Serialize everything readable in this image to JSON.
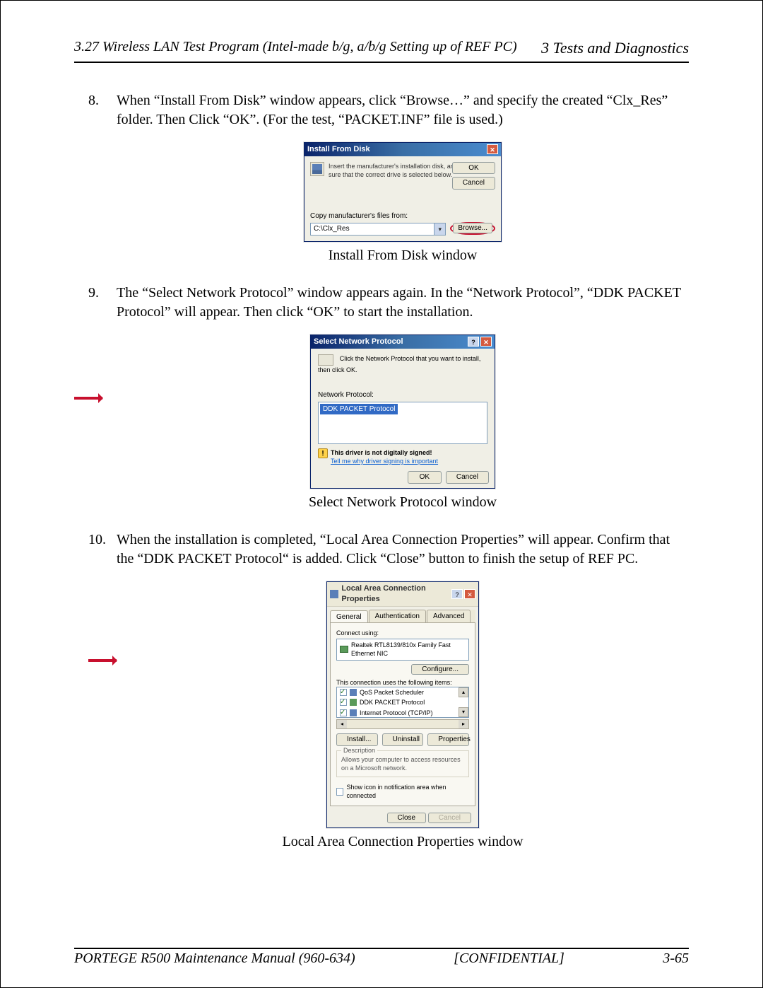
{
  "header": {
    "left": "3.27 Wireless LAN Test Program (Intel-made b/g, a/b/g Setting up of REF PC)",
    "right": "3  Tests and Diagnostics"
  },
  "steps": {
    "s8_num": "8.",
    "s8_text": "When “Install From Disk” window appears, click “Browse…” and specify the created “Clx_Res” folder. Then Click “OK”. (For the test, “PACKET.INF” file is used.)",
    "s9_num": "9.",
    "s9_text": "The “Select Network Protocol” window appears again. In the “Network Protocol”, “DDK PACKET Protocol” will appear. Then click “OK” to start the installation.",
    "s10_num": "10.",
    "s10_text": "When the installation is completed, “Local Area Connection Properties” will appear. Confirm that the “DDK PACKET Protocol“ is added. Click “Close” button to finish the setup of REF PC."
  },
  "captions": {
    "c1": "Install From Disk window",
    "c2": "Select Network Protocol window",
    "c3": "Local Area Connection Properties window"
  },
  "ifd": {
    "title": "Install From Disk",
    "msg": "Insert the manufacturer's installation disk, and then make sure that the correct drive is selected below.",
    "ok": "OK",
    "cancel": "Cancel",
    "copy_label": "Copy manufacturer's files from:",
    "path": "C:\\Clx_Res",
    "browse": "Browse..."
  },
  "snp": {
    "title": "Select Network Protocol",
    "msg": "Click the Network Protocol that you want to install, then click OK.",
    "label": "Network Protocol:",
    "item": "DDK PACKET Protocol",
    "warn_bold": "This driver is not digitally signed!",
    "warn_link": "Tell me why driver signing is important",
    "ok": "OK",
    "cancel": "Cancel"
  },
  "lac": {
    "title": "Local Area Connection Properties",
    "tabs": {
      "general": "General",
      "auth": "Authentication",
      "adv": "Advanced"
    },
    "connect_label": "Connect using:",
    "adapter": "Realtek RTL8139/810x Family Fast Ethernet NIC",
    "configure": "Configure...",
    "uses_label": "This connection uses the following items:",
    "items": {
      "i1": "QoS Packet Scheduler",
      "i2": "DDK PACKET Protocol",
      "i3": "Internet Protocol (TCP/IP)"
    },
    "install": "Install...",
    "uninstall": "Uninstall",
    "properties": "Properties",
    "desc_legend": "Description",
    "desc_text": "Allows your computer to access resources on a Microsoft network.",
    "show_icon": "Show icon in notification area when connected",
    "close": "Close",
    "cancel": "Cancel"
  },
  "footer": {
    "left": "PORTEGE R500 Maintenance Manual (960-634)",
    "mid": "[CONFIDENTIAL]",
    "right": "3-65"
  }
}
